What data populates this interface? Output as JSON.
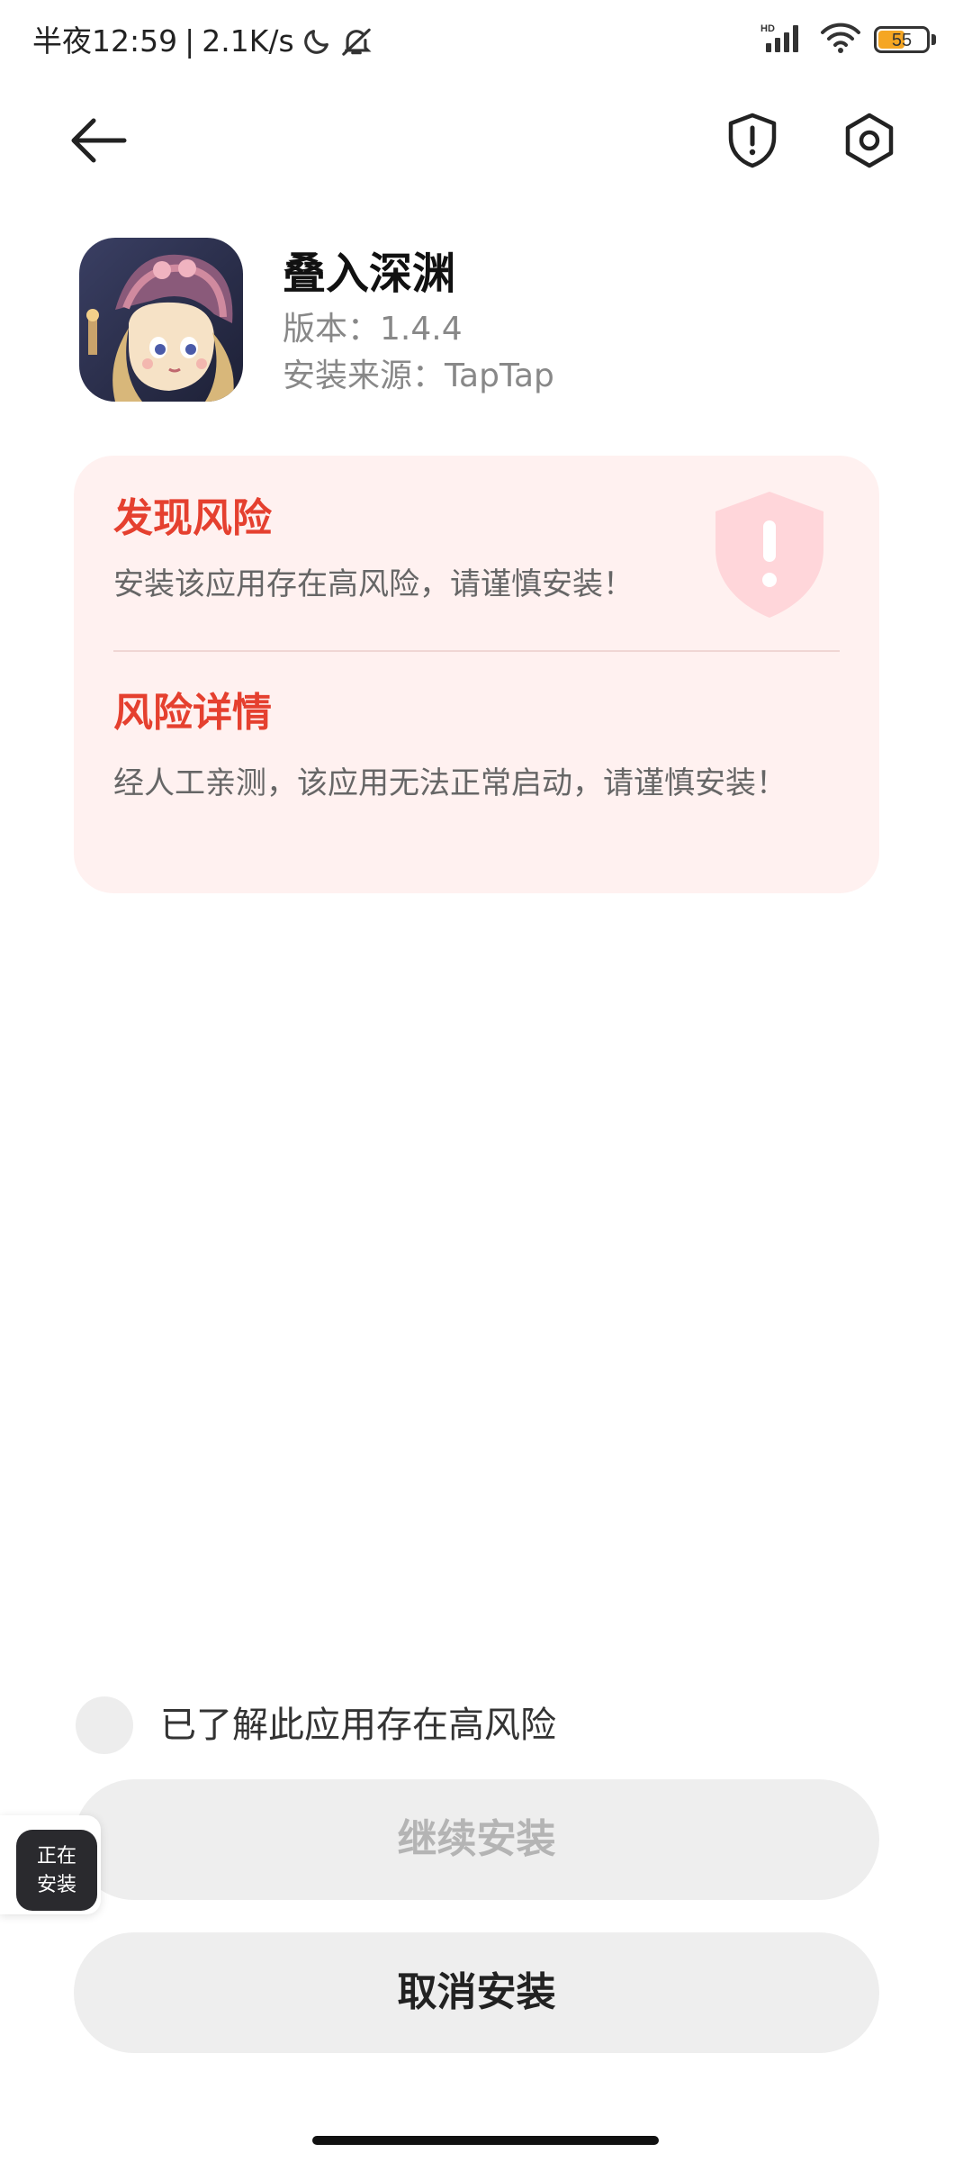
{
  "status_bar": {
    "time": "半夜12:59",
    "separator": "|",
    "speed": "2.1K/s",
    "battery_level": "55",
    "battery_fraction": 0.55,
    "icons": [
      "moon-icon",
      "mute-icon",
      "hd-signal-icon",
      "wifi-icon",
      "battery-icon"
    ]
  },
  "nav": {
    "back_icon": "back-arrow-icon",
    "shield_icon": "shield-alert-icon",
    "settings_icon": "gear-icon"
  },
  "app": {
    "name": "叠入深渊",
    "version": "版本：1.4.4",
    "source": "安装来源：TapTap"
  },
  "risk": {
    "title": "发现风险",
    "description": "安装该应用存在高风险，请谨慎安装！",
    "detail_title": "风险详情",
    "detail_description": "经人工亲测，该应用无法正常启动，请谨慎安装！"
  },
  "actions": {
    "ack_label": "已了解此应用存在高风险",
    "continue_label": "继续安装",
    "cancel_label": "取消安装"
  },
  "install_chip": {
    "text": "正在\n安装"
  },
  "colors": {
    "risk_red": "#e5402f",
    "risk_bg": "#fff1f0",
    "button_bg": "#eeeeee",
    "disabled_text": "#b4b4b4"
  }
}
